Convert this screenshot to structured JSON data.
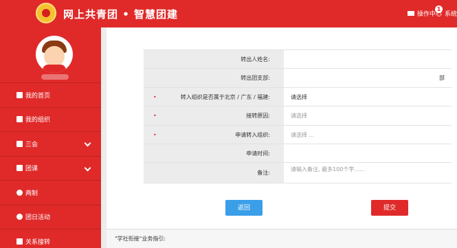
{
  "header": {
    "title": "网上共青团 • 智慧团建",
    "op_center": "操作中心",
    "badge": "1",
    "system": "系统"
  },
  "sidebar": {
    "items": [
      {
        "label": "我的首页",
        "icon": "home-icon"
      },
      {
        "label": "我的组织",
        "icon": "users-icon"
      },
      {
        "label": "三会",
        "icon": "edit-icon",
        "expandable": true
      },
      {
        "label": "团课",
        "icon": "folder-icon",
        "expandable": true
      },
      {
        "label": "两制",
        "icon": "circle-icon"
      },
      {
        "label": "团日活动",
        "icon": "recycle-icon"
      },
      {
        "label": "关系接转",
        "icon": "transfer-icon"
      }
    ]
  },
  "form": {
    "rows": [
      {
        "label": "转出人姓名:",
        "value": "",
        "required": false
      },
      {
        "label": "转出团支部:",
        "value": "部",
        "required": false
      },
      {
        "label": "转入组织是否属于北京 / 广东 / 福建:",
        "value": "请选择",
        "required": true
      },
      {
        "label": "接转原因:",
        "value": "请选择",
        "required": true
      },
      {
        "label": "申请转入组织:",
        "value": "请选择 ...",
        "required": true
      },
      {
        "label": "申请时间:",
        "value": "",
        "required": false
      },
      {
        "label": "备注:",
        "value": "请输入备注, 最多100个字......",
        "required": false
      }
    ],
    "back_label": "返回",
    "submit_label": "提交"
  },
  "guide": {
    "text": "\"学社衔接\"业务指引:"
  },
  "colors": {
    "brand_red": "#e02a2a",
    "button_blue": "#3a9ee8"
  }
}
